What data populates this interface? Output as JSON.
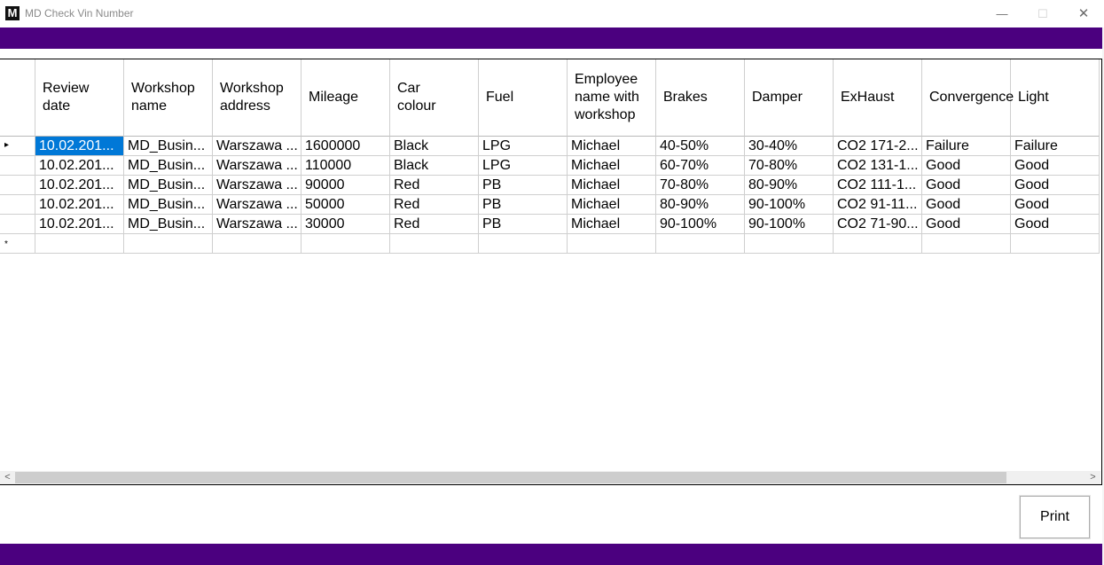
{
  "window": {
    "title": "MD Check Vin Number",
    "icon_glyph": "M",
    "minimize_glyph": "—",
    "maximize_glyph": "☐",
    "close_glyph": "✕"
  },
  "colors": {
    "brand_band": "#4b007f",
    "selection": "#0078d7"
  },
  "grid": {
    "columns": [
      {
        "label": "Review\ndate"
      },
      {
        "label": "Workshop\nname"
      },
      {
        "label": "Workshop\naddress"
      },
      {
        "label": "Mileage"
      },
      {
        "label": "Car\ncolour"
      },
      {
        "label": "Fuel"
      },
      {
        "label": "Employee\nname with\nworkshop"
      },
      {
        "label": "Brakes"
      },
      {
        "label": "Damper"
      },
      {
        "label": "ExHaust"
      },
      {
        "label": "Convergence"
      },
      {
        "label": "Light"
      }
    ],
    "rows": [
      {
        "row_marker": "▸",
        "cells": [
          "10.02.201...",
          "MD_Busin...",
          "Warszawa ...",
          "1600000",
          "Black",
          "LPG",
          "Michael",
          "40-50%",
          "30-40%",
          "CO2 171-2...",
          "Failure",
          "Failure"
        ]
      },
      {
        "row_marker": "",
        "cells": [
          "10.02.201...",
          "MD_Busin...",
          "Warszawa ...",
          "110000",
          "Black",
          "LPG",
          "Michael",
          "60-70%",
          "70-80%",
          "CO2 131-1...",
          "Good",
          "Good"
        ]
      },
      {
        "row_marker": "",
        "cells": [
          "10.02.201...",
          "MD_Busin...",
          "Warszawa ...",
          "90000",
          "Red",
          "PB",
          "Michael",
          "70-80%",
          "80-90%",
          "CO2 111-1...",
          "Good",
          "Good"
        ]
      },
      {
        "row_marker": "",
        "cells": [
          "10.02.201...",
          "MD_Busin...",
          "Warszawa ...",
          "50000",
          "Red",
          "PB",
          "Michael",
          "80-90%",
          "90-100%",
          "CO2 91-11...",
          "Good",
          "Good"
        ]
      },
      {
        "row_marker": "",
        "cells": [
          "10.02.201...",
          "MD_Busin...",
          "Warszawa ...",
          "30000",
          "Red",
          "PB",
          "Michael",
          "90-100%",
          "90-100%",
          "CO2 71-90...",
          "Good",
          "Good"
        ]
      }
    ],
    "new_row_marker": "*",
    "selected_cell": {
      "row": 0,
      "col": 0
    },
    "scroll_left_glyph": "<",
    "scroll_right_glyph": ">"
  },
  "actions": {
    "print_label": "Print"
  }
}
